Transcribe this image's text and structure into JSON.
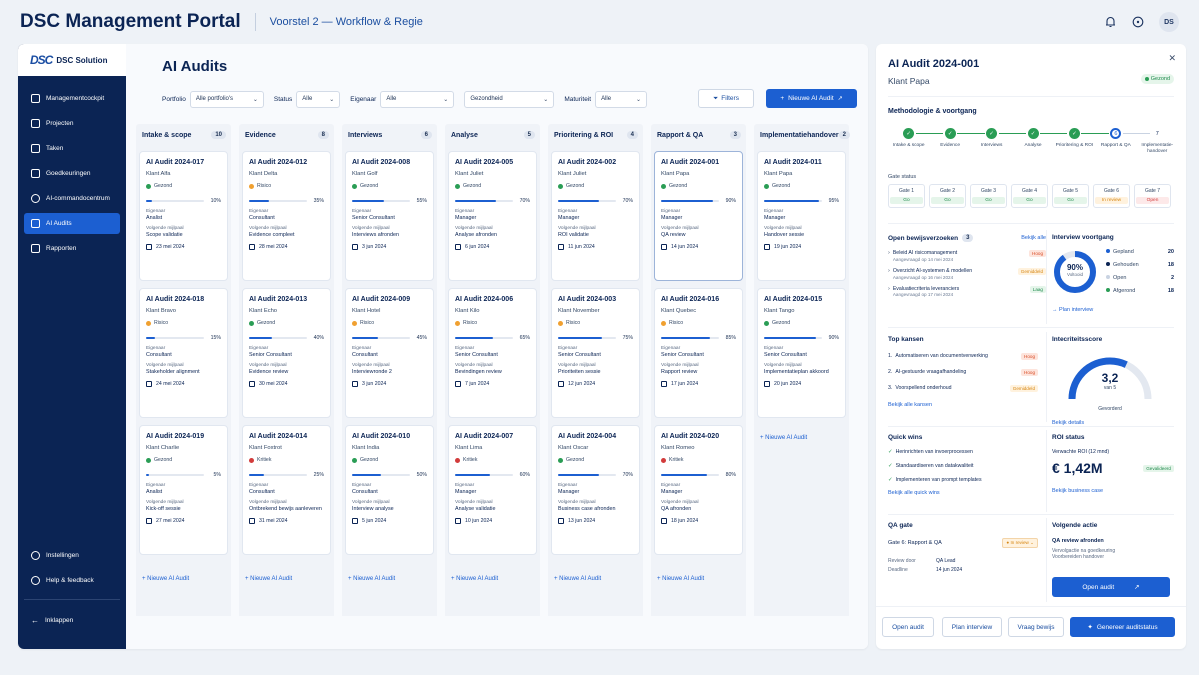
{
  "app": {
    "title": "DSC Management Portal",
    "subtitle": "Voorstel 2 — Workflow & Regie",
    "avatar": "DS"
  },
  "sidebar": {
    "logo_mark": "DSC",
    "logo_text": "DSC Solution",
    "items": [
      {
        "label": "Managementcockpit"
      },
      {
        "label": "Projecten"
      },
      {
        "label": "Taken"
      },
      {
        "label": "Goedkeuringen"
      },
      {
        "label": "AI-commandocentrum"
      },
      {
        "label": "AI Audits"
      },
      {
        "label": "Rapporten"
      }
    ],
    "bottom": [
      {
        "label": "Instellingen"
      },
      {
        "label": "Help & feedback"
      },
      {
        "label": "Inklappen"
      }
    ]
  },
  "page": {
    "title": "AI Audits",
    "filters": {
      "portfolio_label": "Portfolio",
      "portfolio_value": "Alle portfolio's",
      "status_label": "Status",
      "status_value": "Alle",
      "owner_label": "Eigenaar",
      "owner_value": "Alle",
      "health_value": "Gezondheid",
      "maturity_label": "Maturiteit",
      "maturity_value": "Alle"
    },
    "filters_button": "Filters",
    "new_button": "Nieuwe AI Audit",
    "add_label": "+ Nieuwe AI Audit"
  },
  "labels": {
    "owner": "Eigenaar",
    "milestone": "Volgende mijlpaal"
  },
  "colors": {
    "healthy": "#2a9d55",
    "risk": "#f0a030",
    "critical": "#d23b3b",
    "accent": "#1c5fd1"
  },
  "columns": [
    {
      "title": "Intake & scope",
      "count": "10",
      "cards": [
        {
          "title": "AI Audit 2024-017",
          "client": "Klant Alfa",
          "status": "Gezond",
          "color": "healthy",
          "progress": 10,
          "owner": "Analist",
          "milestone": "Scope validatie",
          "date": "23 mei 2024"
        },
        {
          "title": "AI Audit 2024-018",
          "client": "Klant Bravo",
          "status": "Risico",
          "color": "risk",
          "progress": 15,
          "owner": "Consultant",
          "milestone": "Stakeholder alignment",
          "date": "24 mei 2024"
        },
        {
          "title": "AI Audit 2024-019",
          "client": "Klant Charlie",
          "status": "Gezond",
          "color": "healthy",
          "progress": 5,
          "owner": "Analist",
          "milestone": "Kick-off sessie",
          "date": "27 mei 2024"
        }
      ]
    },
    {
      "title": "Evidence",
      "count": "8",
      "cards": [
        {
          "title": "AI Audit 2024-012",
          "client": "Klant Delta",
          "status": "Risico",
          "color": "risk",
          "progress": 35,
          "owner": "Consultant",
          "milestone": "Evidence compleet",
          "date": "28 mei 2024"
        },
        {
          "title": "AI Audit 2024-013",
          "client": "Klant Echo",
          "status": "Gezond",
          "color": "healthy",
          "progress": 40,
          "owner": "Senior Consultant",
          "milestone": "Evidence review",
          "date": "30 mei 2024"
        },
        {
          "title": "AI Audit 2024-014",
          "client": "Klant Foxtrot",
          "status": "Kritiek",
          "color": "critical",
          "progress": 25,
          "owner": "Consultant",
          "milestone": "Ontbrekend bewijs aanleveren",
          "date": "31 mei 2024"
        }
      ]
    },
    {
      "title": "Interviews",
      "count": "6",
      "cards": [
        {
          "title": "AI Audit 2024-008",
          "client": "Klant Golf",
          "status": "Gezond",
          "color": "healthy",
          "progress": 55,
          "owner": "Senior Consultant",
          "milestone": "Interviews afronden",
          "date": "3 jun 2024"
        },
        {
          "title": "AI Audit 2024-009",
          "client": "Klant Hotel",
          "status": "Risico",
          "color": "risk",
          "progress": 45,
          "owner": "Consultant",
          "milestone": "Interviewronde 2",
          "date": "3 jun 2024"
        },
        {
          "title": "AI Audit 2024-010",
          "client": "Klant India",
          "status": "Gezond",
          "color": "healthy",
          "progress": 50,
          "owner": "Consultant",
          "milestone": "Interview analyse",
          "date": "5 jun 2024"
        }
      ]
    },
    {
      "title": "Analyse",
      "count": "5",
      "cards": [
        {
          "title": "AI Audit 2024-005",
          "client": "Klant Juliet",
          "status": "Gezond",
          "color": "healthy",
          "progress": 70,
          "owner": "Manager",
          "milestone": "Analyse afronden",
          "date": "6 jun 2024"
        },
        {
          "title": "AI Audit 2024-006",
          "client": "Klant Kilo",
          "status": "Risico",
          "color": "risk",
          "progress": 65,
          "owner": "Senior Consultant",
          "milestone": "Bevindingen review",
          "date": "7 jun 2024"
        },
        {
          "title": "AI Audit 2024-007",
          "client": "Klant Lima",
          "status": "Kritiek",
          "color": "critical",
          "progress": 60,
          "owner": "Manager",
          "milestone": "Analyse validatie",
          "date": "10 jun 2024"
        }
      ]
    },
    {
      "title": "Prioritering & ROI",
      "count": "4",
      "cards": [
        {
          "title": "AI Audit 2024-002",
          "client": "Klant Juliet",
          "status": "Gezond",
          "color": "healthy",
          "progress": 70,
          "owner": "Manager",
          "milestone": "ROI validatie",
          "date": "11 jun 2024"
        },
        {
          "title": "AI Audit 2024-003",
          "client": "Klant November",
          "status": "Risico",
          "color": "risk",
          "progress": 75,
          "owner": "Senior Consultant",
          "milestone": "Prioriteiten sessie",
          "date": "12 jun 2024"
        },
        {
          "title": "AI Audit 2024-004",
          "client": "Klant Oscar",
          "status": "Gezond",
          "color": "healthy",
          "progress": 70,
          "owner": "Manager",
          "milestone": "Business case afronden",
          "date": "13 jun 2024"
        }
      ]
    },
    {
      "title": "Rapport & QA",
      "count": "3",
      "cards": [
        {
          "title": "AI Audit 2024-001",
          "client": "Klant Papa",
          "status": "Gezond",
          "color": "healthy",
          "progress": 90,
          "owner": "Manager",
          "milestone": "QA review",
          "date": "14 jun 2024",
          "selected": true
        },
        {
          "title": "AI Audit 2024-016",
          "client": "Klant Quebec",
          "status": "Risico",
          "color": "risk",
          "progress": 85,
          "owner": "Senior Consultant",
          "milestone": "Rapport review",
          "date": "17 jun 2024"
        },
        {
          "title": "AI Audit 2024-020",
          "client": "Klant Romeo",
          "status": "Kritiek",
          "color": "critical",
          "progress": 80,
          "owner": "Manager",
          "milestone": "QA afronden",
          "date": "18 jun 2024"
        }
      ]
    },
    {
      "title": "Implementatiehandover",
      "count": "2",
      "cards": [
        {
          "title": "AI Audit 2024-011",
          "client": "Klant Papa",
          "status": "Gezond",
          "color": "healthy",
          "progress": 95,
          "owner": "Manager",
          "milestone": "Handover sessie",
          "date": "19 jun 2024"
        },
        {
          "title": "AI Audit 2024-015",
          "client": "Klant Tango",
          "status": "Gezond",
          "color": "healthy",
          "progress": 90,
          "owner": "Senior Consultant",
          "milestone": "Implementatieplan akkoord",
          "date": "20 jun 2024"
        }
      ]
    }
  ],
  "detail": {
    "title": "AI Audit 2024-001",
    "client": "Klant Papa",
    "health": "Gezond",
    "method_title": "Methodologie & voortgang",
    "steps": [
      {
        "num": "1",
        "label": "Intake & scope",
        "state": "done"
      },
      {
        "num": "2",
        "label": "Evidence",
        "state": "done"
      },
      {
        "num": "3",
        "label": "Interviews",
        "state": "done"
      },
      {
        "num": "4",
        "label": "Analyse",
        "state": "done"
      },
      {
        "num": "5",
        "label": "Prioritering & ROI",
        "state": "done"
      },
      {
        "num": "6",
        "label": "Rapport & QA",
        "state": "current"
      },
      {
        "num": "7",
        "label": "Implementatie-handover",
        "state": "todo"
      }
    ],
    "gate_status_label": "Gate status",
    "gates": [
      {
        "name": "Gate 1",
        "status": "Go",
        "kind": "go"
      },
      {
        "name": "Gate 2",
        "status": "Go",
        "kind": "go"
      },
      {
        "name": "Gate 3",
        "status": "Go",
        "kind": "go"
      },
      {
        "name": "Gate 4",
        "status": "Go",
        "kind": "go"
      },
      {
        "name": "Gate 5",
        "status": "Go",
        "kind": "go"
      },
      {
        "name": "Gate 6",
        "status": "In review",
        "kind": "rev"
      },
      {
        "name": "Gate 7",
        "status": "Open",
        "kind": "open"
      }
    ],
    "evidence": {
      "title": "Open bewijsverzoeken",
      "count": "3",
      "link": "Bekijk alle",
      "items": [
        {
          "title": "Beleid AI risicomanagement",
          "sub": "Aangevraagd op 14 mei 2024",
          "tag": "Hoog",
          "kind": "high"
        },
        {
          "title": "Overzicht AI-systemen & modellen",
          "sub": "Aangevraagd op 16 mei 2024",
          "tag": "Gemiddeld",
          "kind": "mid"
        },
        {
          "title": "Evaluatiecriteria leveranciers",
          "sub": "Aangevraagd op 17 mei 2024",
          "tag": "Laag",
          "kind": "low"
        }
      ]
    },
    "interviews": {
      "title": "Interview voortgang",
      "percent": "90%",
      "percent_value": 90,
      "percent_label": "Voltooid",
      "rows": [
        {
          "label": "Gepland",
          "value": "20"
        },
        {
          "label": "Gehouden",
          "value": "18"
        },
        {
          "label": "Open",
          "value": "2"
        },
        {
          "label": "Afgerond",
          "value": "18"
        }
      ],
      "link": "Plan interview"
    },
    "opportunities": {
      "title": "Top kansen",
      "link": "Bekijk alle kansen",
      "items": [
        {
          "num": "1.",
          "title": "Automatiseren van documentverwerking",
          "tag": "Hoog",
          "kind": "high"
        },
        {
          "num": "2.",
          "title": "AI-gestuurde vraagafhandeling",
          "tag": "Hoog",
          "kind": "high"
        },
        {
          "num": "3.",
          "title": "Voorspellend onderhoud",
          "tag": "Gemiddeld",
          "kind": "mid"
        }
      ]
    },
    "integrity": {
      "title": "Intecriteitsscore",
      "score": "3,2",
      "score_value": 3.2,
      "max": "van 5",
      "level": "Gevorderd",
      "link": "Bekijk details"
    },
    "quickwins": {
      "title": "Quick wins",
      "link": "Bekijk alle quick wins",
      "items": [
        "Herinrichten van invoerprocessen",
        "Standaardiseren van datakwaliteit",
        "Implementeren van prompt templates"
      ]
    },
    "roi": {
      "title": "ROI status",
      "label": "Verwachte ROI (12 mnd)",
      "value": "€ 1,42M",
      "badge": "Gevalideerd",
      "link": "Bekijk business case"
    },
    "qa": {
      "title": "QA gate",
      "gate": "Gate 6: Rapport & QA",
      "status": "In review",
      "reviewer_label": "Review door",
      "reviewer": "QA Lead",
      "deadline_label": "Deadline",
      "deadline": "14 jun 2024"
    },
    "next": {
      "title": "Volgende actie",
      "action": "QA review afronden",
      "line1": "Vervolgactie na goedkeuring",
      "line2": "Voorbereiden handover"
    },
    "open_button": "Open audit",
    "bottom_buttons": [
      "Open audit",
      "Plan interview",
      "Vraag bewijs",
      "Genereer auditstatus"
    ]
  }
}
